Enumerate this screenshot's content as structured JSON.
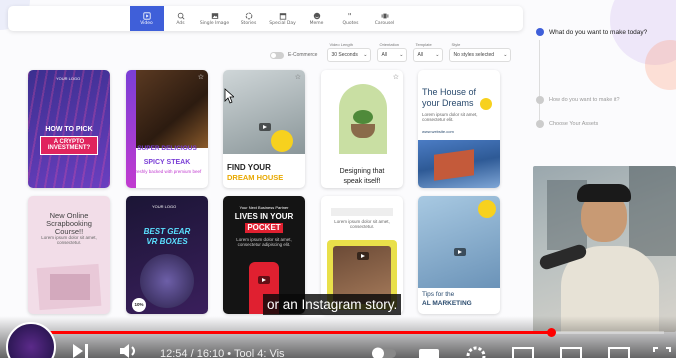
{
  "toolbar": {
    "tabs": [
      {
        "label": "Video",
        "icon": "video-icon",
        "active": true
      },
      {
        "label": "Ads",
        "icon": "megaphone-icon"
      },
      {
        "label": "Single Image",
        "icon": "image-icon"
      },
      {
        "label": "Stories",
        "icon": "stories-icon"
      },
      {
        "label": "Special Day",
        "icon": "calendar-icon"
      },
      {
        "label": "Meme",
        "icon": "smile-icon"
      },
      {
        "label": "Quotes",
        "icon": "quote-icon"
      },
      {
        "label": "Carousel",
        "icon": "carousel-icon"
      }
    ]
  },
  "filters": {
    "ecommerce_label": "E-Commerce",
    "video_length": {
      "label": "Video Length",
      "value": "30 Seconds"
    },
    "orientation": {
      "label": "Orientation",
      "value": "All"
    },
    "template": {
      "label": "Template",
      "value": "All"
    },
    "style": {
      "label": "Style",
      "value": "No styles selected"
    }
  },
  "steps": {
    "step1": "What do you want to make today?",
    "step2": "How do you want to make it?",
    "step3": "Choose Your Assets"
  },
  "cards": {
    "c1": {
      "logo": "YOUR LOGO",
      "line1": "HOW TO PICK",
      "line2": "A CRYPTO INVESTMENT?"
    },
    "c2": {
      "line1": "SUPER DELICIOUS",
      "line2": "SPICY STEAK",
      "line3": "Freshly backed with premium beef"
    },
    "c3": {
      "line1": "FIND YOUR",
      "line2": "DREAM HOUSE"
    },
    "c4": {
      "line1": "Designing that",
      "line2": "speak itself!"
    },
    "c5": {
      "line1": "The House of",
      "line2": "your Dreams",
      "body": "Lorem ipsum dolor sit amet, consectetur elit.",
      "url": "www.website.com"
    },
    "c6": {
      "line1": "New Online Scrapbooking Course!!",
      "body": "Lorem ipsum dolor sit amet, consectetur."
    },
    "c7": {
      "logo": "YOUR LOGO",
      "line1": "BEST GEAR",
      "line2": "VR BOXES",
      "badge": "10%"
    },
    "c8": {
      "line0": "Your Next Business Partner",
      "line1": "LIVES IN YOUR",
      "line2": "POCKET",
      "body": "Lorem ipsum dolor sit amet, consectetur adipiscing elit."
    },
    "c9": {
      "body": "Lorem ipsum dolor sit amet, consectetur."
    },
    "c10": {
      "line1": "Tips for the",
      "line2": "AL MARKETING"
    }
  },
  "video": {
    "subtitle": "or an Instagram story.",
    "time": "12:54 / 16:10 • Tool 4: Vis",
    "progress": 0.83
  },
  "colors": {
    "accent": "#3f5fd9",
    "progress": "#ff0000"
  }
}
